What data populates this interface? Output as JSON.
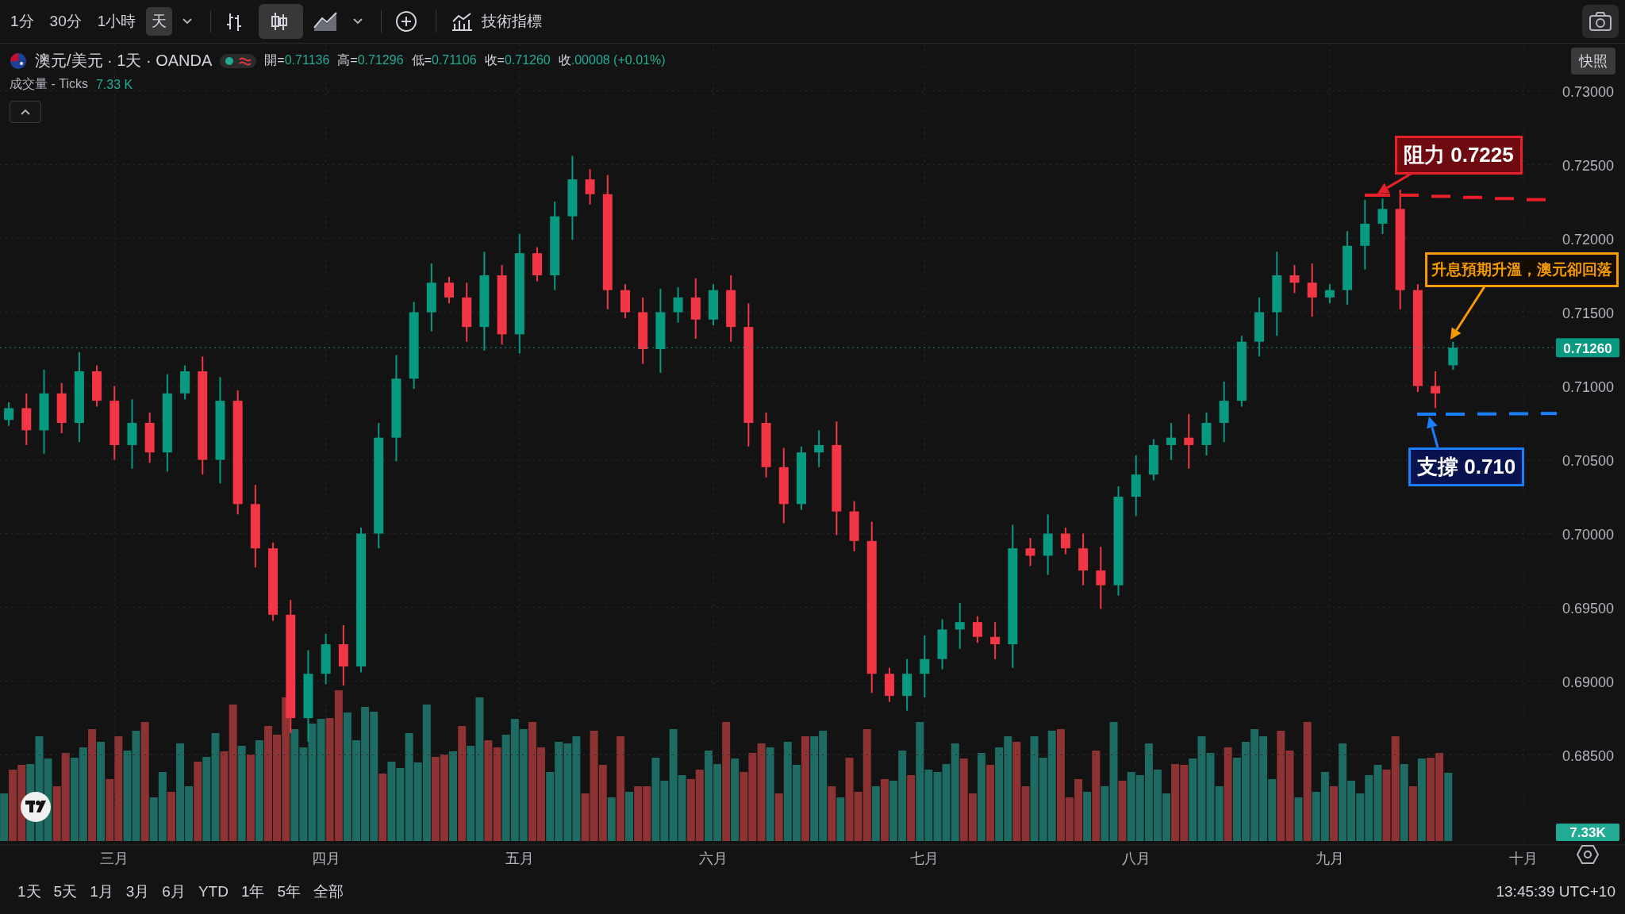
{
  "toolbar": {
    "intervals": [
      {
        "label": "1分",
        "selected": false
      },
      {
        "label": "30分",
        "selected": false
      },
      {
        "label": "1小時",
        "selected": false
      },
      {
        "label": "天",
        "selected": true
      }
    ],
    "chart_types": [
      {
        "kind": "bars",
        "selected": false
      },
      {
        "kind": "candles",
        "selected": true
      },
      {
        "kind": "area",
        "selected": false
      }
    ],
    "indicators_button": "技術指標"
  },
  "snapshot_tooltip": "快照",
  "legend": {
    "symbol": "澳元/美元 · 1天 · OANDA",
    "ohlc": [
      {
        "label": "開=",
        "value": "0.71136"
      },
      {
        "label": "高=",
        "value": "0.71296"
      },
      {
        "label": "低=",
        "value": "0.71106"
      },
      {
        "label": "收=",
        "value": "0.71260"
      },
      {
        "label": "收",
        "value": ".00008 (+0.01%)"
      }
    ],
    "volume_label": "成交量 - Ticks",
    "volume_value": "7.33 K"
  },
  "chart": {
    "last_price": "0.71260",
    "volume_badge": "7.33K",
    "chart_data": {
      "type": "candlestick",
      "grid": true,
      "ylim": [
        0.6789,
        0.7332
      ],
      "categories": [
        null,
        null,
        null,
        null,
        null,
        null,
        "三月",
        null,
        null,
        null,
        null,
        null,
        null,
        null,
        null,
        null,
        null,
        null,
        "四月",
        null,
        null,
        null,
        null,
        null,
        null,
        null,
        null,
        null,
        null,
        "五月",
        null,
        null,
        null,
        null,
        null,
        null,
        null,
        null,
        null,
        null,
        "六月",
        null,
        null,
        null,
        null,
        null,
        null,
        null,
        null,
        null,
        null,
        null,
        "七月",
        null,
        null,
        null,
        null,
        null,
        null,
        null,
        null,
        null,
        null,
        null,
        "八月",
        null,
        null,
        null,
        null,
        null,
        null,
        null,
        null,
        null,
        null,
        "九月",
        null,
        null,
        null,
        null,
        null,
        null,
        null,
        null,
        null,
        null,
        "十月"
      ],
      "ohlc": [
        [
          0.7077,
          0.7089,
          0.7073,
          0.7085
        ],
        [
          0.7085,
          0.7095,
          0.706,
          0.707
        ],
        [
          0.707,
          0.7111,
          0.7054,
          0.7095
        ],
        [
          0.7095,
          0.7102,
          0.7068,
          0.7075
        ],
        [
          0.7075,
          0.7123,
          0.7062,
          0.711
        ],
        [
          0.711,
          0.7114,
          0.7086,
          0.709
        ],
        [
          0.709,
          0.71,
          0.705,
          0.706
        ],
        [
          0.706,
          0.7091,
          0.7044,
          0.7075
        ],
        [
          0.7075,
          0.7082,
          0.7048,
          0.7055
        ],
        [
          0.7055,
          0.7108,
          0.7042,
          0.7095
        ],
        [
          0.7095,
          0.7114,
          0.7091,
          0.711
        ],
        [
          0.711,
          0.712,
          0.704,
          0.705
        ],
        [
          0.705,
          0.7106,
          0.7034,
          0.709
        ],
        [
          0.709,
          0.7097,
          0.7013,
          0.702
        ],
        [
          0.702,
          0.7033,
          0.6977,
          0.699
        ],
        [
          0.699,
          0.6994,
          0.6941,
          0.6945
        ],
        [
          0.6945,
          0.6955,
          0.6865,
          0.6875
        ],
        [
          0.6875,
          0.6921,
          0.6859,
          0.6905
        ],
        [
          0.6905,
          0.6932,
          0.6898,
          0.6925
        ],
        [
          0.6925,
          0.6938,
          0.6897,
          0.691
        ],
        [
          0.691,
          0.7004,
          0.6906,
          0.7
        ],
        [
          0.7,
          0.7075,
          0.699,
          0.7065
        ],
        [
          0.7065,
          0.7121,
          0.7049,
          0.7105
        ],
        [
          0.7105,
          0.7157,
          0.7098,
          0.715
        ],
        [
          0.715,
          0.7183,
          0.7137,
          0.717
        ],
        [
          0.717,
          0.7174,
          0.7156,
          0.716
        ],
        [
          0.716,
          0.717,
          0.713,
          0.714
        ],
        [
          0.714,
          0.7191,
          0.7124,
          0.7175
        ],
        [
          0.7175,
          0.7182,
          0.7128,
          0.7135
        ],
        [
          0.7135,
          0.7203,
          0.7122,
          0.719
        ],
        [
          0.719,
          0.7194,
          0.7171,
          0.7175
        ],
        [
          0.7175,
          0.7225,
          0.7165,
          0.7215
        ],
        [
          0.7215,
          0.7256,
          0.7199,
          0.724
        ],
        [
          0.724,
          0.7247,
          0.7223,
          0.723
        ],
        [
          0.723,
          0.7243,
          0.7152,
          0.7165
        ],
        [
          0.7165,
          0.7169,
          0.7146,
          0.715
        ],
        [
          0.715,
          0.716,
          0.7115,
          0.7125
        ],
        [
          0.7125,
          0.7166,
          0.7109,
          0.715
        ],
        [
          0.715,
          0.7167,
          0.7143,
          0.716
        ],
        [
          0.716,
          0.7173,
          0.7132,
          0.7145
        ],
        [
          0.7145,
          0.7169,
          0.7141,
          0.7165
        ],
        [
          0.7165,
          0.7175,
          0.713,
          0.714
        ],
        [
          0.714,
          0.7156,
          0.7059,
          0.7075
        ],
        [
          0.7075,
          0.7082,
          0.7038,
          0.7045
        ],
        [
          0.7045,
          0.7058,
          0.7007,
          0.702
        ],
        [
          0.702,
          0.7059,
          0.7016,
          0.7055
        ],
        [
          0.7055,
          0.707,
          0.7045,
          0.706
        ],
        [
          0.706,
          0.7076,
          0.6999,
          0.7015
        ],
        [
          0.7015,
          0.7022,
          0.6988,
          0.6995
        ],
        [
          0.6995,
          0.7008,
          0.6892,
          0.6905
        ],
        [
          0.6905,
          0.6909,
          0.6886,
          0.689
        ],
        [
          0.689,
          0.6915,
          0.688,
          0.6905
        ],
        [
          0.6905,
          0.6931,
          0.6889,
          0.6915
        ],
        [
          0.6915,
          0.6942,
          0.6908,
          0.6935
        ],
        [
          0.6935,
          0.6953,
          0.6922,
          0.694
        ],
        [
          0.694,
          0.6944,
          0.6926,
          0.693
        ],
        [
          0.693,
          0.694,
          0.6915,
          0.6925
        ],
        [
          0.6925,
          0.7006,
          0.6909,
          0.699
        ],
        [
          0.699,
          0.6997,
          0.6978,
          0.6985
        ],
        [
          0.6985,
          0.7013,
          0.6972,
          0.7
        ],
        [
          0.7,
          0.7004,
          0.6986,
          0.699
        ],
        [
          0.699,
          0.7,
          0.6965,
          0.6975
        ],
        [
          0.6975,
          0.6991,
          0.6949,
          0.6965
        ],
        [
          0.6965,
          0.7032,
          0.6958,
          0.7025
        ],
        [
          0.7025,
          0.7053,
          0.7012,
          0.704
        ],
        [
          0.704,
          0.7064,
          0.7036,
          0.706
        ],
        [
          0.706,
          0.7075,
          0.705,
          0.7065
        ],
        [
          0.7065,
          0.7081,
          0.7044,
          0.706
        ],
        [
          0.706,
          0.7082,
          0.7053,
          0.7075
        ],
        [
          0.7075,
          0.7103,
          0.7062,
          0.709
        ],
        [
          0.709,
          0.7134,
          0.7086,
          0.713
        ],
        [
          0.713,
          0.716,
          0.712,
          0.715
        ],
        [
          0.715,
          0.7191,
          0.7134,
          0.7175
        ],
        [
          0.7175,
          0.7182,
          0.7163,
          0.717
        ],
        [
          0.717,
          0.7183,
          0.7147,
          0.716
        ],
        [
          0.716,
          0.7169,
          0.7156,
          0.7165
        ],
        [
          0.7165,
          0.7205,
          0.7155,
          0.7195
        ],
        [
          0.7195,
          0.7226,
          0.7179,
          0.721
        ],
        [
          0.721,
          0.7227,
          0.7203,
          0.722
        ],
        [
          0.722,
          0.7233,
          0.7152,
          0.7165
        ],
        [
          0.7165,
          0.7169,
          0.7096,
          0.71
        ],
        [
          0.71,
          0.711,
          0.7085,
          0.7095
        ],
        [
          0.7114,
          0.713,
          0.7111,
          0.7126
        ],
        null,
        null,
        null,
        null
      ],
      "yticks": [
        {
          "value": 0.685,
          "label": "0.68500"
        },
        {
          "value": 0.69,
          "label": "0.69000"
        },
        {
          "value": 0.695,
          "label": "0.69500"
        },
        {
          "value": 0.7,
          "label": "0.70000"
        },
        {
          "value": 0.705,
          "label": "0.70500"
        },
        {
          "value": 0.71,
          "label": "0.71000"
        },
        {
          "value": 0.715,
          "label": "0.71500"
        },
        {
          "value": 0.72,
          "label": "0.72000"
        },
        {
          "value": 0.725,
          "label": "0.72500"
        },
        {
          "value": 0.73,
          "label": "0.73000"
        }
      ]
    }
  },
  "annotations": [
    {
      "kind": "resistance",
      "text": "阻力 0.7225",
      "color": "#e8202a"
    },
    {
      "kind": "note",
      "text": "升息預期升溫，澳元卻回落",
      "color": "#f59a00"
    },
    {
      "kind": "support",
      "text": "支撐 0.710",
      "color": "#1a7fff"
    }
  ],
  "range_buttons": [
    "1天",
    "5天",
    "1月",
    "3月",
    "6月",
    "YTD",
    "1年",
    "5年",
    "全部"
  ],
  "clock": "13:45:39 UTC+10"
}
